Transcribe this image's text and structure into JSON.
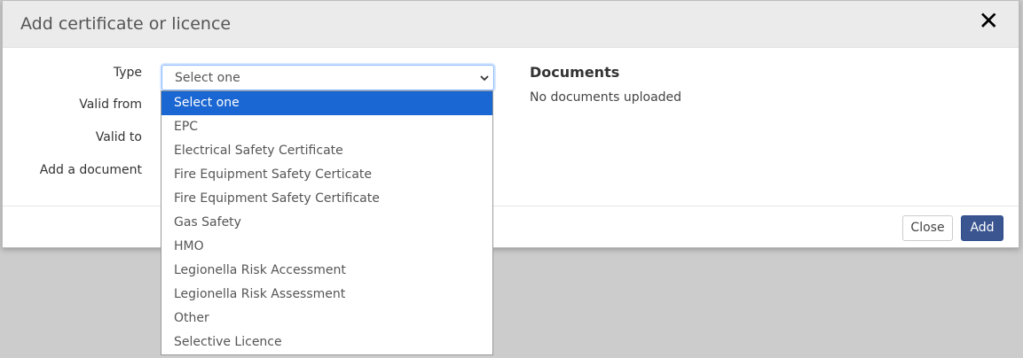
{
  "modal": {
    "title": "Add certificate or licence",
    "close_icon": "close-x-icon",
    "accent_color": "#1a66d2"
  },
  "form": {
    "type_label": "Type",
    "valid_from_label": "Valid from",
    "valid_to_label": "Valid to",
    "add_document_label": "Add a document",
    "type_selected": "Select one"
  },
  "type_options": [
    "Select one",
    "EPC",
    "Electrical Safety Certificate",
    "Fire Equipment Safety Certicate",
    "Fire Equipment Safety Certificate",
    "Gas Safety",
    "HMO",
    "Legionella Risk Accessment",
    "Legionella Risk Assessment",
    "Other",
    "Selective Licence"
  ],
  "documents": {
    "heading": "Documents",
    "empty_text": "No documents uploaded"
  },
  "footer": {
    "close_label": "Close",
    "add_label": "Add",
    "add_color": "#3a5590"
  }
}
